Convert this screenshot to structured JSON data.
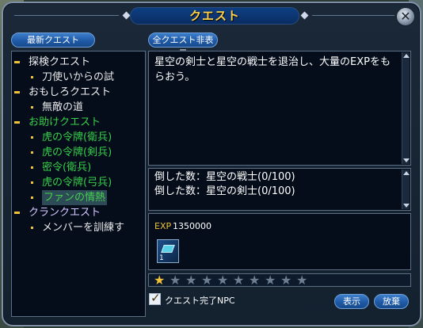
{
  "window": {
    "title": "クエスト",
    "close_label": "✕"
  },
  "buttons": {
    "latest_quest": "最新クエスト",
    "hide_all": "全クエスト非表示",
    "show": "表示",
    "abandon": "放棄"
  },
  "quest_tree": {
    "categories": [
      {
        "label": "探検クエスト",
        "items": [
          {
            "label": "刀使いからの試"
          }
        ]
      },
      {
        "label": "おもしろクエスト",
        "items": [
          {
            "label": "無敵の道"
          }
        ]
      },
      {
        "label": "お助けクエスト",
        "items": [
          {
            "label": "虎の令牌(衛兵)"
          },
          {
            "label": "虎の令牌(剣兵)"
          },
          {
            "label": "密令(衛兵)"
          },
          {
            "label": "虎の令牌(弓兵)"
          },
          {
            "label": "ファンの情熱"
          }
        ]
      },
      {
        "label": "クランクエスト",
        "items": [
          {
            "label": "メンバーを訓練す"
          }
        ]
      }
    ]
  },
  "description": "星空の剣士と星空の戦士を退治し、大量のEXPをもらおう。",
  "targets": [
    "倒した数：星空の戦士(0/100)",
    "倒した数：星空の剣士(0/100)"
  ],
  "reward": {
    "exp_label": "EXP",
    "exp_value": "1350000",
    "item_count": "1"
  },
  "difficulty": {
    "filled": 1,
    "total": 10
  },
  "checkbox": {
    "label": "クエスト完了NPC",
    "checked": true
  }
}
